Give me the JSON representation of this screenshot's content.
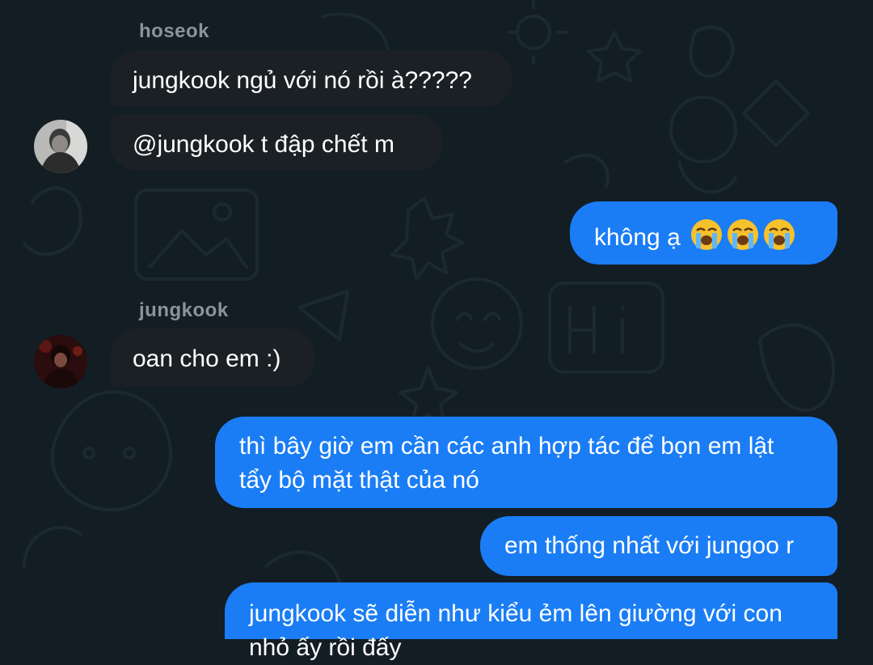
{
  "chat": {
    "messages": [
      {
        "sender": "hoseok",
        "text_1": "jungkook ngủ với nó rồi à?????",
        "text_2": "@jungkook t đập chết m"
      },
      {
        "text": "không ạ",
        "emoji": [
          "loudly-crying-face",
          "loudly-crying-face",
          "loudly-crying-face"
        ]
      },
      {
        "sender": "jungkook",
        "text": "oan cho em :)"
      },
      {
        "line1": "thì bây giờ em cần các anh hợp tác để bọn em lật",
        "line2": "tẩy bộ mặt thật của nó"
      },
      {
        "text": "em thống nhất với jungoo r"
      },
      {
        "line1": "jungkook sẽ diễn như kiểu ẻm lên giường với con",
        "line2": "nhỏ ấy rồi đấy"
      }
    ]
  },
  "colors": {
    "background": "#131d24",
    "incoming_bubble": "#1b2024",
    "outgoing_bubble": "#1a7df5",
    "sender_name": "#8b949c"
  }
}
